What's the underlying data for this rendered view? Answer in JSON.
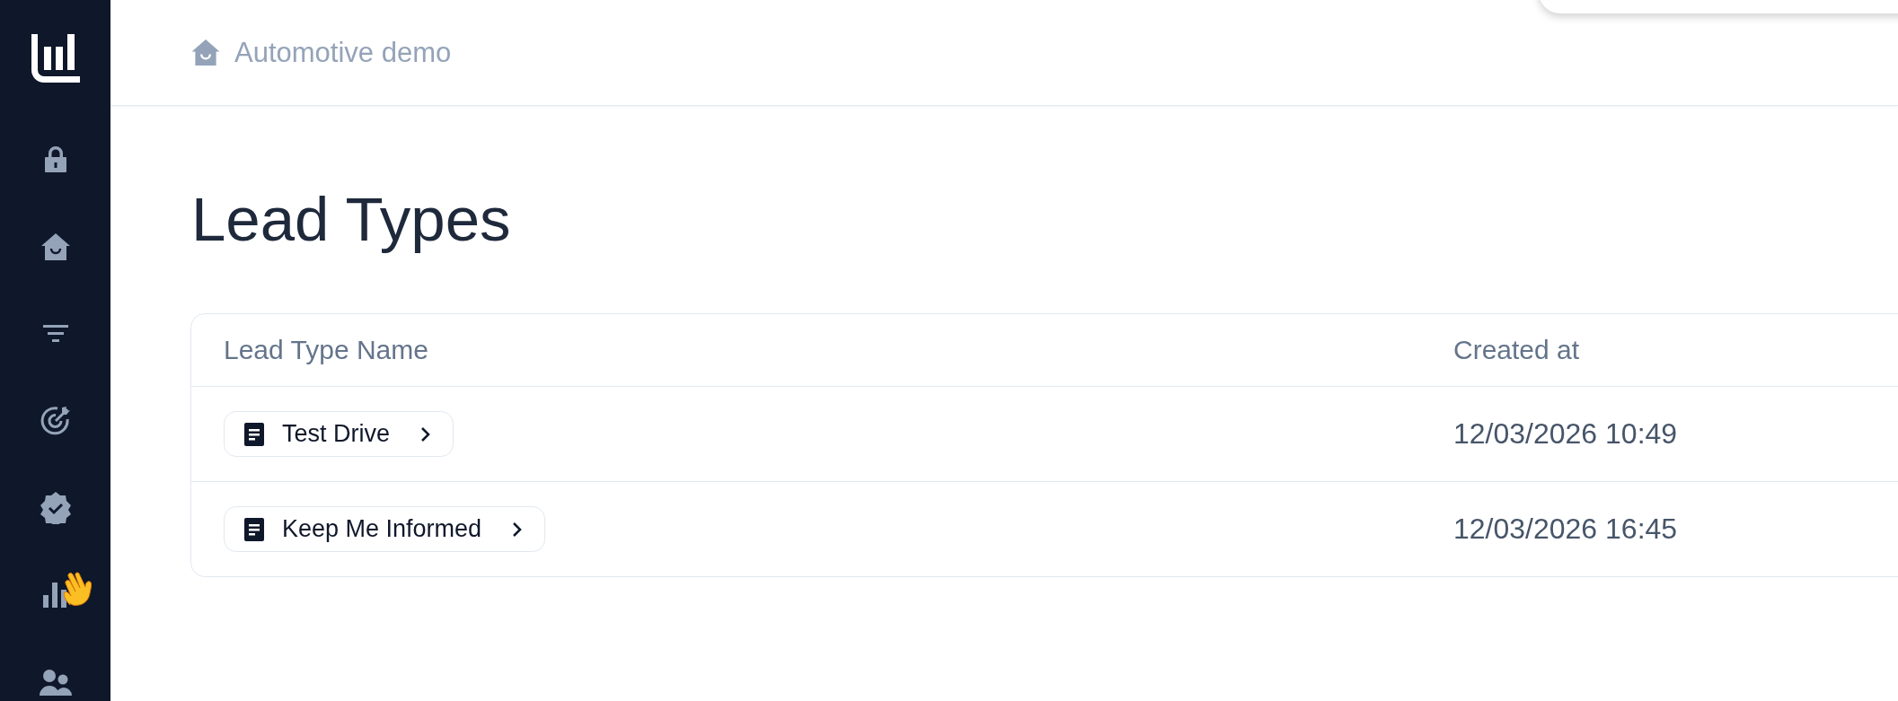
{
  "breadcrumb": {
    "label": "Automotive demo"
  },
  "page_title": "Lead Types",
  "table": {
    "columns": [
      "Lead Type Name",
      "Created at"
    ],
    "rows": [
      {
        "name": "Test Drive",
        "created_at": "12/03/2026 10:49"
      },
      {
        "name": "Keep Me Informed",
        "created_at": "12/03/2026 16:45"
      }
    ]
  }
}
